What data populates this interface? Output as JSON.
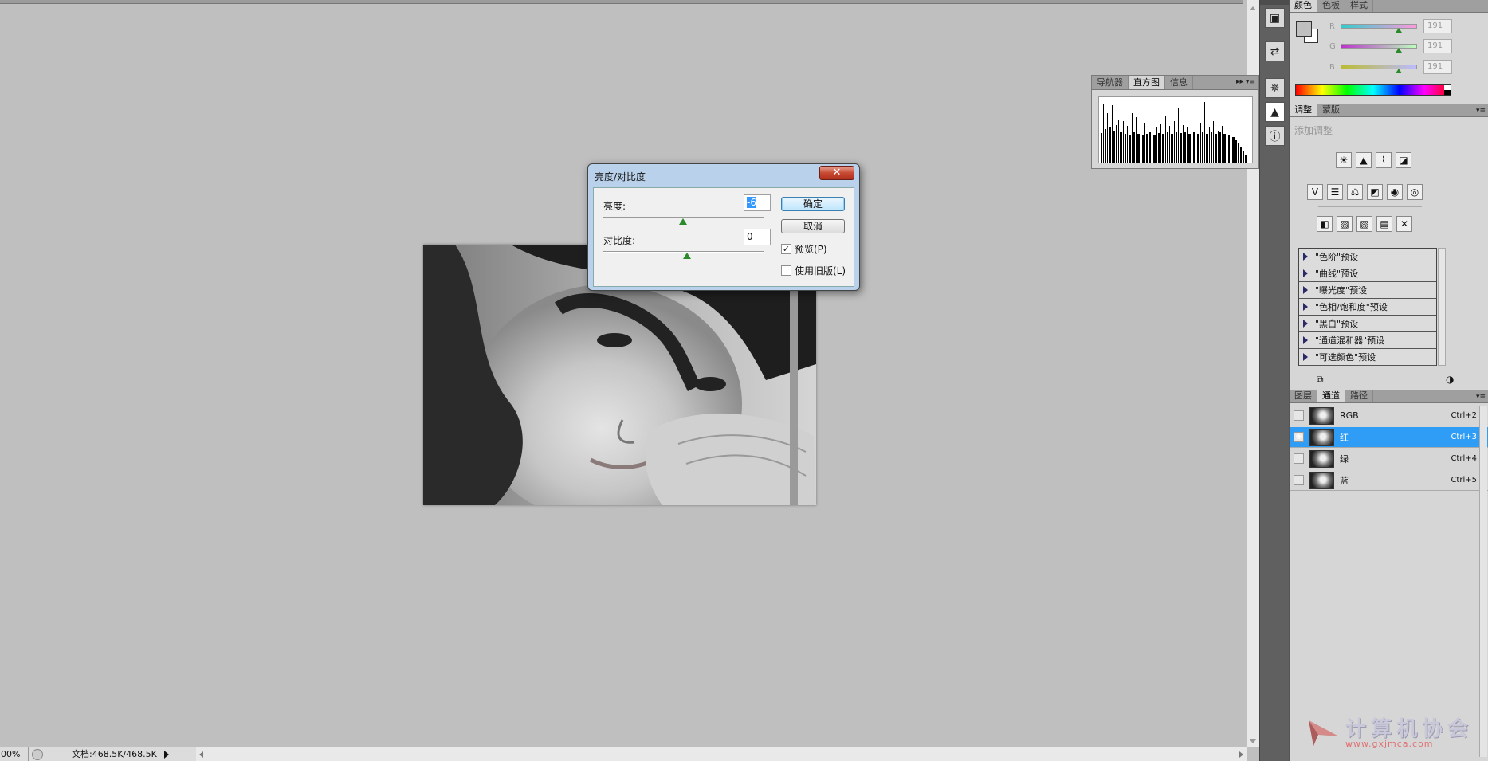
{
  "window": {
    "zoom": "00%",
    "doc_info": "文档:468.5K/468.5K"
  },
  "histogram_panel": {
    "tabs": [
      "导航器",
      "直方图",
      "信息"
    ],
    "active_tab": "直方图"
  },
  "color_panel": {
    "tabs": [
      "颜色",
      "色板",
      "样式"
    ],
    "r": {
      "label": "R",
      "value": "191"
    },
    "g": {
      "label": "G",
      "value": "191"
    },
    "b": {
      "label": "B",
      "value": "191"
    },
    "fg_color": "#bfbfbf",
    "bg_color": "#ffffff"
  },
  "adjustments_panel": {
    "tabs": [
      "调整",
      "蒙版"
    ],
    "hint": "添加调整",
    "presets": [
      "\"色阶\"预设",
      "\"曲线\"预设",
      "\"曝光度\"预设",
      "\"色相/饱和度\"预设",
      "\"黑白\"预设",
      "\"通道混和器\"预设",
      "\"可选颜色\"预设"
    ]
  },
  "channels_panel": {
    "tabs": [
      "图层",
      "通道",
      "路径"
    ],
    "active_tab": "通道",
    "channels": [
      {
        "name": "RGB",
        "shortcut": "Ctrl+2",
        "visible": false,
        "selected": false
      },
      {
        "name": "红",
        "shortcut": "Ctrl+3",
        "visible": true,
        "selected": true
      },
      {
        "name": "绿",
        "shortcut": "Ctrl+4",
        "visible": false,
        "selected": false
      },
      {
        "name": "蓝",
        "shortcut": "Ctrl+5",
        "visible": false,
        "selected": false
      }
    ]
  },
  "dialog": {
    "title": "亮度/对比度",
    "close": "✕",
    "brightness_label": "亮度:",
    "brightness_value": "-6",
    "contrast_label": "对比度:",
    "contrast_value": "0",
    "ok": "确定",
    "cancel": "取消",
    "preview_label": "预览(P)",
    "preview_checked": true,
    "legacy_label": "使用旧版(L)",
    "legacy_checked": false
  },
  "watermark": {
    "title": "计算机协会",
    "url": "www.gxjmca.com"
  },
  "colors": {
    "selection": "#2f9cf5",
    "dialog_frame": "#b9d1ea",
    "slider_knob": "#2c8a2c"
  }
}
